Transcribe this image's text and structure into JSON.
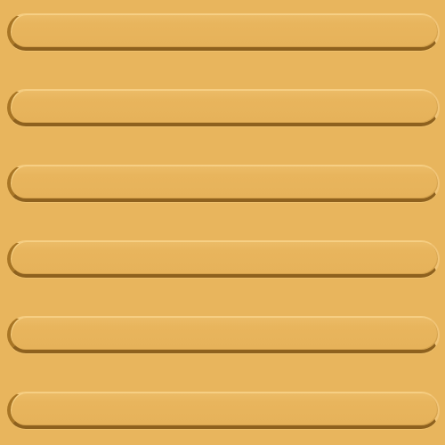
{
  "tile": {
    "background_color": "#e8b55d",
    "bar_count": 6,
    "bar_highlight_color": "#f6cd82",
    "bar_shadow_color": "#8e611e"
  },
  "bars": [
    {
      "id": 1
    },
    {
      "id": 2
    },
    {
      "id": 3
    },
    {
      "id": 4
    },
    {
      "id": 5
    },
    {
      "id": 6
    }
  ]
}
